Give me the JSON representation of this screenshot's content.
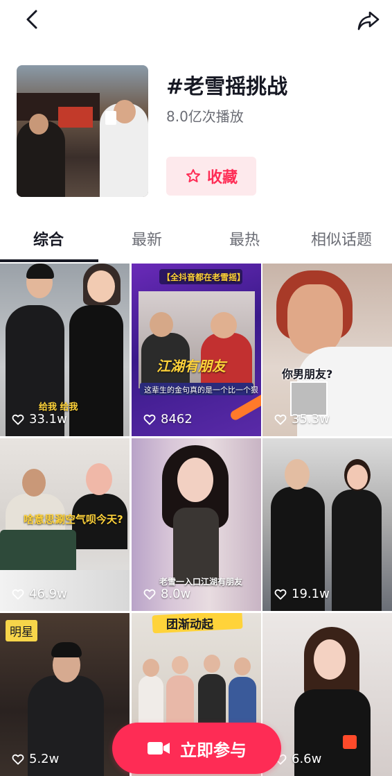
{
  "topbar": {
    "back_icon": "back-arrow-icon",
    "share_icon": "share-arrow-icon"
  },
  "topic": {
    "title": "#老雪摇挑战",
    "plays": "8.0亿次播放",
    "collect_label": "收藏"
  },
  "tabs": [
    {
      "label": "综合",
      "active": true
    },
    {
      "label": "最新",
      "active": false
    },
    {
      "label": "最热",
      "active": false
    },
    {
      "label": "相似话题",
      "active": false
    }
  ],
  "videos": [
    {
      "likes": "33.1w",
      "caption": "给我 给我"
    },
    {
      "likes": "8462",
      "caption_top": "【全抖音都在老雪摇】",
      "caption": "江湖有朋友",
      "subcaption": "这辈生的金句真的是一个比一个狠"
    },
    {
      "likes": "35.3w",
      "caption": "你男朋友?"
    },
    {
      "likes": "46.9w",
      "caption": "啥意思涮空气呗今天?"
    },
    {
      "likes": "8.0w",
      "caption": "老雪一入口江湖有朋友"
    },
    {
      "likes": "19.1w",
      "caption": ""
    },
    {
      "likes": "5.2w",
      "badge": "明星"
    },
    {
      "likes": "",
      "caption_top": "团渐动起"
    },
    {
      "likes": "6.6w"
    }
  ],
  "cta": {
    "label": "立即参与",
    "icon": "video-camera-icon"
  },
  "colors": {
    "accent": "#fe2c55",
    "accent_bg": "#fde9ec",
    "text": "#161823",
    "muted": "#6b6d75"
  }
}
